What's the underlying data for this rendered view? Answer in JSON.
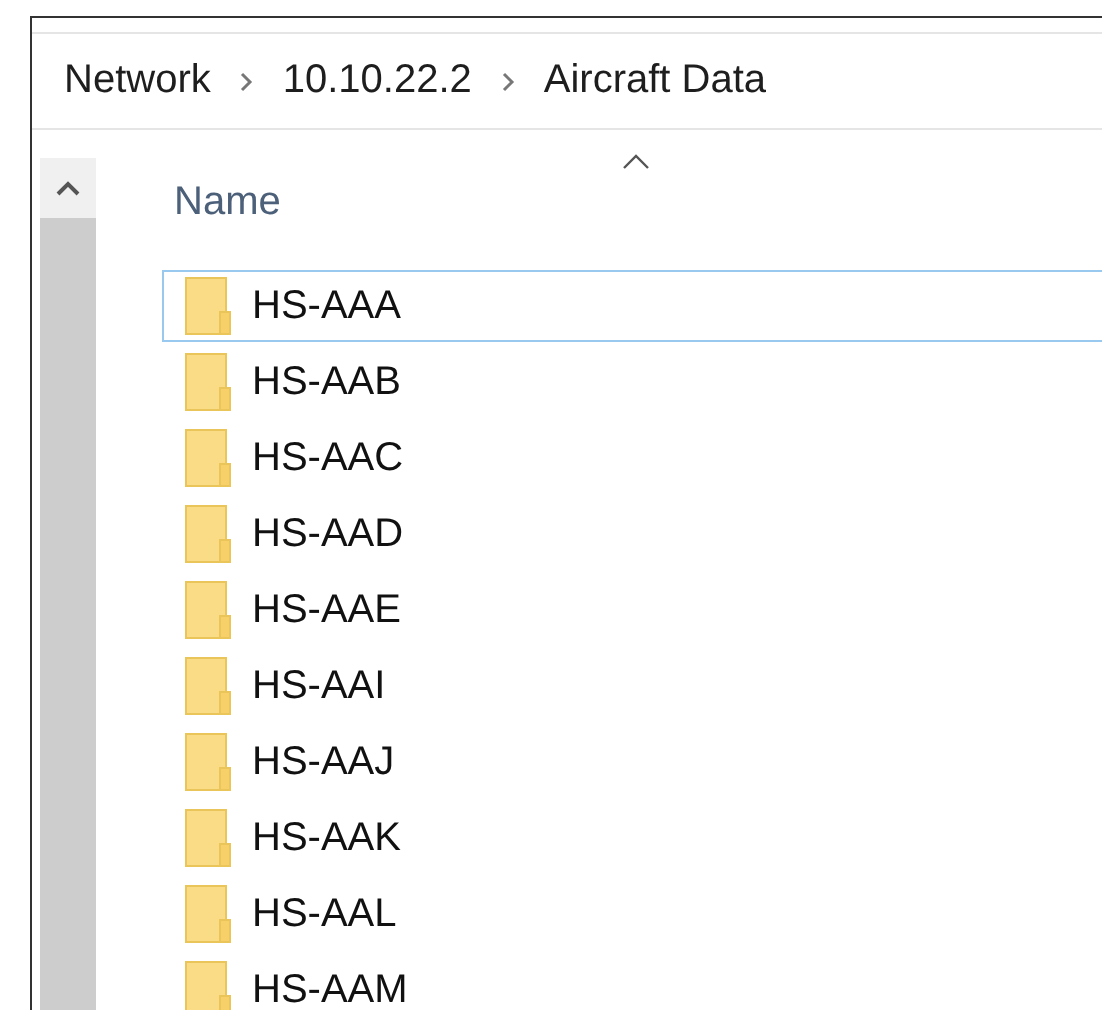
{
  "breadcrumb": [
    "Network",
    "10.10.22.2",
    "Aircraft Data"
  ],
  "column_header": {
    "label": "Name",
    "sorted": true
  },
  "files": [
    {
      "name": "HS-AAA",
      "selected": true
    },
    {
      "name": "HS-AAB",
      "selected": false
    },
    {
      "name": "HS-AAC",
      "selected": false
    },
    {
      "name": "HS-AAD",
      "selected": false
    },
    {
      "name": "HS-AAE",
      "selected": false
    },
    {
      "name": "HS-AAI",
      "selected": false
    },
    {
      "name": "HS-AAJ",
      "selected": false
    },
    {
      "name": "HS-AAK",
      "selected": false
    },
    {
      "name": "HS-AAL",
      "selected": false
    },
    {
      "name": "HS-AAM",
      "selected": false
    }
  ]
}
